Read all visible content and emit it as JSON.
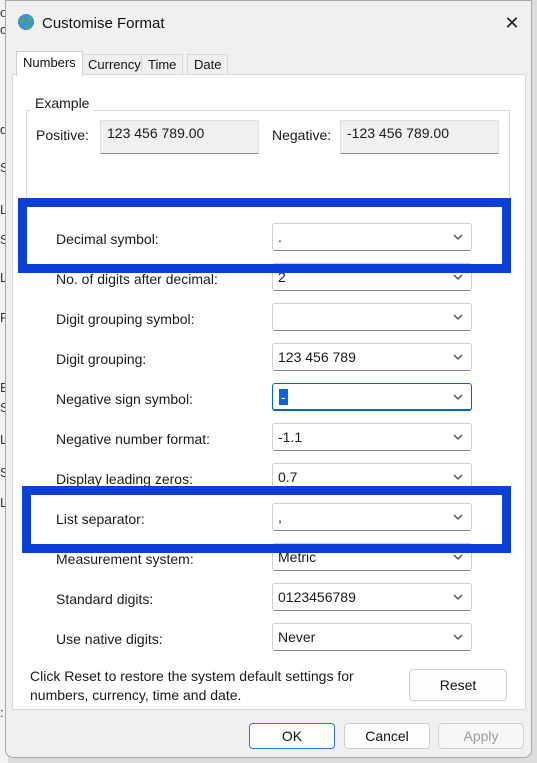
{
  "window": {
    "title": "Customise Format",
    "close_glyph": "✕"
  },
  "background_letters": [
    "o",
    "c",
    "",
    "",
    "",
    "d",
    "",
    "",
    "",
    "S",
    "",
    "",
    "",
    "L",
    "",
    "S",
    "",
    "L",
    "",
    "F",
    "",
    "",
    "",
    "E",
    "S",
    "L",
    "S",
    "L",
    "",
    ":"
  ],
  "tabs": [
    {
      "label": "Numbers",
      "active": true
    },
    {
      "label": "Currency"
    },
    {
      "label": "Time"
    },
    {
      "label": "Date"
    }
  ],
  "example": {
    "group_title": "Example",
    "positive_label": "Positive:",
    "positive_value": "123 456 789.00",
    "negative_label": "Negative:",
    "negative_value": "-123 456 789.00"
  },
  "settings": [
    {
      "label": "Decimal symbol:",
      "value": "."
    },
    {
      "label": "No. of digits after decimal:",
      "value": "2"
    },
    {
      "label": "Digit grouping symbol:",
      "value": ""
    },
    {
      "label": "Digit grouping:",
      "value": "123 456 789"
    },
    {
      "label": "Negative sign symbol:",
      "value": "-"
    },
    {
      "label": "Negative number format:",
      "value": "-1.1"
    },
    {
      "label": "Display leading zeros:",
      "value": "0.7"
    },
    {
      "label": "List separator:",
      "value": ","
    },
    {
      "label": "Measurement system:",
      "value": "Metric"
    },
    {
      "label": "Standard digits:",
      "value": "0123456789"
    },
    {
      "label": "Use native digits:",
      "value": "Never"
    }
  ],
  "reset": {
    "description": "Click Reset to restore the system default settings for numbers, currency, time and date.",
    "button": "Reset"
  },
  "footer": {
    "ok": "OK",
    "cancel": "Cancel",
    "apply": "Apply"
  },
  "colors": {
    "highlight": "#0b3fd6",
    "selection": "#0a64d8",
    "focus": "#0067c0"
  },
  "icons": {
    "app": "globe-icon",
    "close": "close-icon",
    "dropdown": "chevron-down-icon"
  }
}
